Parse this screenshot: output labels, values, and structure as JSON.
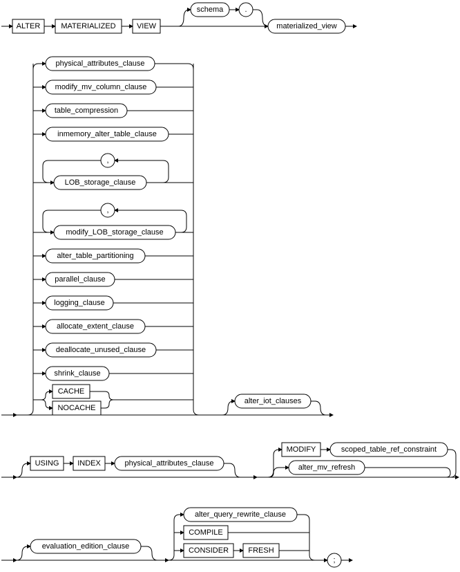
{
  "diagram": {
    "kw_alter": "ALTER",
    "kw_materialized": "MATERIALIZED",
    "kw_view": "VIEW",
    "nt_schema": "schema",
    "lit_dot": ".",
    "nt_materialized_view": "materialized_view",
    "nt_physical_attributes_clause": "physical_attributes_clause",
    "nt_modify_mv_column_clause": "modify_mv_column_clause",
    "nt_table_compression": "table_compression",
    "nt_inmemory_alter_table_clause": "inmemory_alter_table_clause",
    "lit_comma1": ",",
    "nt_lob_storage_clause": "LOB_storage_clause",
    "lit_comma2": ",",
    "nt_modify_lob_storage_clause": "modify_LOB_storage_clause",
    "nt_alter_table_partitioning": "alter_table_partitioning",
    "nt_parallel_clause": "parallel_clause",
    "nt_logging_clause": "logging_clause",
    "nt_allocate_extent_clause": "allocate_extent_clause",
    "nt_deallocate_unused_clause": "deallocate_unused_clause",
    "nt_shrink_clause": "shrink_clause",
    "kw_cache": "CACHE",
    "kw_nocache": "NOCACHE",
    "nt_alter_iot_clauses": "alter_iot_clauses",
    "kw_using": "USING",
    "kw_index": "INDEX",
    "nt_physical_attributes_clause2": "physical_attributes_clause",
    "kw_modify": "MODIFY",
    "nt_scoped_table_ref_constraint": "scoped_table_ref_constraint",
    "nt_alter_mv_refresh": "alter_mv_refresh",
    "nt_evaluation_edition_clause": "evaluation_edition_clause",
    "nt_alter_query_rewrite_clause": "alter_query_rewrite_clause",
    "kw_compile": "COMPILE",
    "kw_consider": "CONSIDER",
    "kw_fresh": "FRESH",
    "lit_semi": ";"
  }
}
